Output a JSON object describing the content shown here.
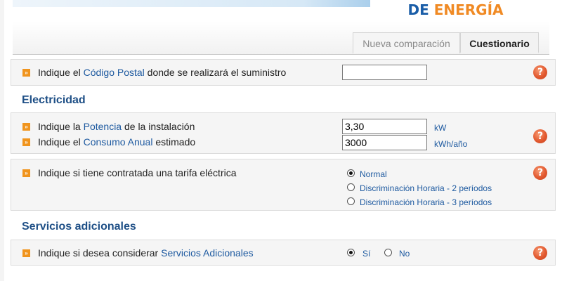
{
  "brand": {
    "logo_part1": "DE",
    "logo_part2": "ENERGÍA"
  },
  "tabs": [
    {
      "label": "Nueva comparación",
      "active": false
    },
    {
      "label": "Cuestionario",
      "active": true
    }
  ],
  "postal": {
    "text_pre": "Indique el ",
    "text_link": "Código Postal",
    "text_post": " donde se realizará el suministro",
    "value": ""
  },
  "electricidad": {
    "title": "Electricidad",
    "potencia": {
      "text_pre": "Indique la ",
      "text_link": "Potencia",
      "text_post": " de la instalación",
      "value": "3,30",
      "unit": "kW"
    },
    "consumo": {
      "text_pre": "Indique el ",
      "text_link": "Consumo Anual",
      "text_post": " estimado",
      "value": "3000",
      "unit": "kWh/año"
    }
  },
  "tarifa": {
    "label": "Indique si tiene contratada una tarifa eléctrica",
    "options": [
      {
        "label": "Normal",
        "selected": true
      },
      {
        "label": "Discriminación Horaria - 2 períodos",
        "selected": false
      },
      {
        "label": "Discriminación Horaria - 3 períodos",
        "selected": false
      }
    ]
  },
  "servicios": {
    "title": "Servicios adicionales",
    "text_pre": "Indique si desea considerar ",
    "text_link": "Servicios Adicionales",
    "options": [
      {
        "label": "Sí",
        "selected": true
      },
      {
        "label": "No",
        "selected": false
      }
    ]
  },
  "icons": {
    "bullet": "arrow-right-icon",
    "help": "question-mark-icon",
    "bullet_glyph": "»",
    "help_glyph": "?"
  },
  "colors": {
    "accent_orange": "#f0941d",
    "link_blue": "#1e5aa0",
    "help_red": "#e2592f"
  }
}
